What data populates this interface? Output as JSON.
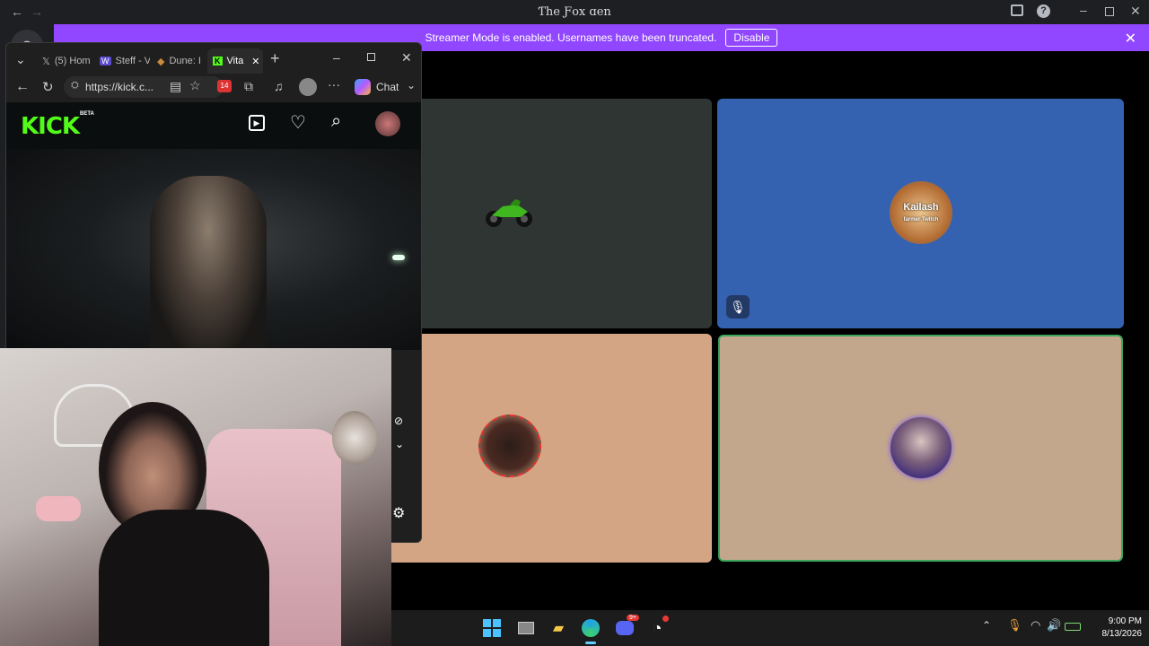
{
  "discord": {
    "window_title": "Ƭhe Ƒox ɑen",
    "back_icon": "arrow-left-icon",
    "forward_icon": "arrow-right-icon",
    "banner_text": "Streamer Mode is enabled. Usernames have been truncated.",
    "banner_button": "Disable"
  },
  "tiles": [
    {
      "color": "#2f3532",
      "avatar": "motorcycle"
    },
    {
      "color": "#3462b0",
      "avatar_text": "Kailash",
      "avatar_sub": "farmer Twitch"
    },
    {
      "color": "#d3a585",
      "avatar": "anime-character"
    },
    {
      "color": "#c2a78d",
      "avatar": "person-portrait",
      "speaking_color": "#3ba55c"
    }
  ],
  "browser": {
    "tabs": [
      {
        "label": "(5) Hom",
        "icon": "x-logo-icon"
      },
      {
        "label": "Steff - V",
        "icon": "app-icon"
      },
      {
        "label": "Dune: I",
        "icon": "game-icon"
      },
      {
        "label": "Vita",
        "icon": "kick-icon"
      }
    ],
    "url": "https://kick.c...",
    "chat_label": "Chat",
    "badge_count": "14"
  },
  "kick": {
    "logo": "KICK",
    "beta": "BETA"
  },
  "taskbar": {
    "time": "9:00 PM",
    "date": "8/13/2026",
    "discord_badge": "9+"
  }
}
